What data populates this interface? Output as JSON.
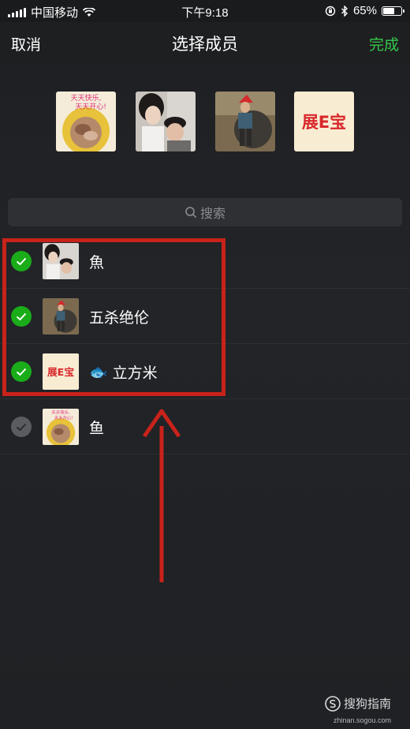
{
  "status": {
    "carrier": "中国移动",
    "time": "下午9:18",
    "battery": "65%",
    "battery_level": 0.65
  },
  "nav": {
    "cancel": "取消",
    "title": "选择成员",
    "done": "完成",
    "accent": "#35c84a"
  },
  "selected_avatars": [
    {
      "name": "avatar-bowl"
    },
    {
      "name": "avatar-couple"
    },
    {
      "name": "avatar-figure"
    },
    {
      "name": "avatar-zhanbao",
      "text": "展E宝"
    }
  ],
  "avatar_texts": {
    "bowl_line1": "天天快乐,",
    "bowl_line2": "天天开心!",
    "zhanbao": "展E宝"
  },
  "search": {
    "placeholder": "搜索"
  },
  "members": [
    {
      "name": "魚",
      "checked": true
    },
    {
      "name": "五杀绝伦",
      "checked": true
    },
    {
      "name": "立方米",
      "checked": true,
      "emoji": "🐟"
    },
    {
      "name": "鱼",
      "checked": false
    }
  ],
  "watermark": {
    "text": "搜狗指南",
    "sub": "zhinan.sogou.com"
  },
  "colors": {
    "check_on": "#1aad19",
    "highlight": "#c8231a"
  }
}
